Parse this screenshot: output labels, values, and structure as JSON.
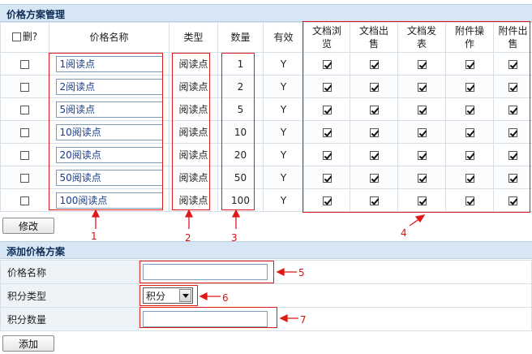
{
  "sections": {
    "price_mgmt_title": "价格方案管理",
    "add_price_title": "添加价格方案"
  },
  "table": {
    "headers": {
      "delete": "删?",
      "name": "价格名称",
      "type": "类型",
      "qty": "数量",
      "valid": "有效",
      "perm1": [
        "文档浏",
        "览"
      ],
      "perm2": [
        "文档出",
        "售"
      ],
      "perm3": [
        "文档发",
        "表"
      ],
      "perm4": [
        "附件操",
        "作"
      ],
      "perm5": [
        "附件出",
        "售"
      ]
    },
    "rows": [
      {
        "name": "1阅读点",
        "type": "阅读点",
        "qty": "1",
        "valid": "Y"
      },
      {
        "name": "2阅读点",
        "type": "阅读点",
        "qty": "2",
        "valid": "Y"
      },
      {
        "name": "5阅读点",
        "type": "阅读点",
        "qty": "5",
        "valid": "Y"
      },
      {
        "name": "10阅读点",
        "type": "阅读点",
        "qty": "10",
        "valid": "Y"
      },
      {
        "name": "20阅读点",
        "type": "阅读点",
        "qty": "20",
        "valid": "Y"
      },
      {
        "name": "50阅读点",
        "type": "阅读点",
        "qty": "50",
        "valid": "Y"
      },
      {
        "name": "100阅读点",
        "type": "阅读点",
        "qty": "100",
        "valid": "Y"
      }
    ]
  },
  "buttons": {
    "modify": "修改",
    "add": "添加"
  },
  "form": {
    "name_label": "价格名称",
    "name_value": "",
    "type_label": "积分类型",
    "type_selected": "积分",
    "qty_label": "积分数量",
    "qty_value": ""
  },
  "annotations": {
    "n1": "1",
    "n2": "2",
    "n3": "3",
    "n4": "4",
    "n5": "5",
    "n6": "6",
    "n7": "7",
    "color": "#e01818"
  },
  "colors": {
    "header_bg": "#d7e6f5",
    "header_text": "#0d2c56",
    "input_text": "#1a3d8a"
  }
}
